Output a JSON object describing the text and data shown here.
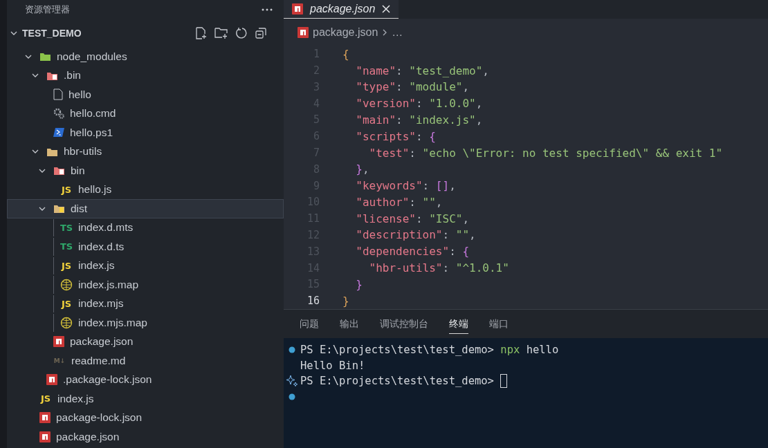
{
  "explorer": {
    "title": "资源管理器",
    "root": {
      "label": "TEST_DEMO",
      "expanded": true
    },
    "tree": [
      {
        "label": "node_modules",
        "kind": "folder-node",
        "expanded": true,
        "selected": false,
        "children": [
          {
            "label": ".bin",
            "kind": "folder-bin",
            "expanded": true,
            "selected": false,
            "children": [
              {
                "label": "hello",
                "kind": "file",
                "selected": false
              },
              {
                "label": "hello.cmd",
                "kind": "gear",
                "selected": false
              },
              {
                "label": "hello.ps1",
                "kind": "powershell",
                "selected": false
              }
            ]
          },
          {
            "label": "hbr-utils",
            "kind": "folder",
            "expanded": true,
            "selected": false,
            "children": [
              {
                "label": "bin",
                "kind": "folder-bin",
                "expanded": true,
                "selected": false,
                "children": [
                  {
                    "label": "hello.js",
                    "kind": "js",
                    "badge": "JS",
                    "selected": false
                  }
                ]
              },
              {
                "label": "dist",
                "kind": "folder-dist",
                "expanded": true,
                "selected": true,
                "children": [
                  {
                    "label": "index.d.mts",
                    "kind": "ts",
                    "badge": "TS",
                    "selected": false
                  },
                  {
                    "label": "index.d.ts",
                    "kind": "ts",
                    "badge": "TS",
                    "selected": false
                  },
                  {
                    "label": "index.js",
                    "kind": "js",
                    "badge": "JS",
                    "selected": false
                  },
                  {
                    "label": "index.js.map",
                    "kind": "map",
                    "selected": false
                  },
                  {
                    "label": "index.mjs",
                    "kind": "js",
                    "badge": "JS",
                    "selected": false
                  },
                  {
                    "label": "index.mjs.map",
                    "kind": "map",
                    "selected": false
                  }
                ]
              },
              {
                "label": "package.json",
                "kind": "npm",
                "selected": false
              },
              {
                "label": "readme.md",
                "kind": "markdown",
                "badge": "M↓",
                "selected": false
              }
            ]
          },
          {
            "label": ".package-lock.json",
            "kind": "npm",
            "selected": false
          }
        ]
      },
      {
        "label": "index.js",
        "kind": "js",
        "badge": "JS",
        "selected": false
      },
      {
        "label": "package-lock.json",
        "kind": "npm",
        "selected": false
      },
      {
        "label": "package.json",
        "kind": "npm",
        "selected": false
      }
    ]
  },
  "editor": {
    "tab": {
      "label": "package.json",
      "selected": true,
      "preview": true
    },
    "breadcrumb": {
      "file": "package.json",
      "more": "…"
    },
    "lines": [
      {
        "number": "1",
        "current": false,
        "tokens": [
          {
            "kind": "brace1",
            "text": "{"
          }
        ]
      },
      {
        "number": "2",
        "current": false,
        "tokens": [
          {
            "kind": "key",
            "text": "  \"name\""
          },
          {
            "kind": "punct",
            "text": ": "
          },
          {
            "kind": "string",
            "text": "\"test_demo\""
          },
          {
            "kind": "punct",
            "text": ","
          }
        ]
      },
      {
        "number": "3",
        "current": false,
        "tokens": [
          {
            "kind": "key",
            "text": "  \"type\""
          },
          {
            "kind": "punct",
            "text": ": "
          },
          {
            "kind": "string",
            "text": "\"module\""
          },
          {
            "kind": "punct",
            "text": ","
          }
        ]
      },
      {
        "number": "4",
        "current": false,
        "tokens": [
          {
            "kind": "key",
            "text": "  \"version\""
          },
          {
            "kind": "punct",
            "text": ": "
          },
          {
            "kind": "string",
            "text": "\"1.0.0\""
          },
          {
            "kind": "punct",
            "text": ","
          }
        ]
      },
      {
        "number": "5",
        "current": false,
        "tokens": [
          {
            "kind": "key",
            "text": "  \"main\""
          },
          {
            "kind": "punct",
            "text": ": "
          },
          {
            "kind": "string",
            "text": "\"index.js\""
          },
          {
            "kind": "punct",
            "text": ","
          }
        ]
      },
      {
        "number": "6",
        "current": false,
        "tokens": [
          {
            "kind": "key",
            "text": "  \"scripts\""
          },
          {
            "kind": "punct",
            "text": ": "
          },
          {
            "kind": "brace2",
            "text": "{"
          }
        ]
      },
      {
        "number": "7",
        "current": false,
        "tokens": [
          {
            "kind": "key",
            "text": "    \"test\""
          },
          {
            "kind": "punct",
            "text": ": "
          },
          {
            "kind": "string",
            "text": "\"echo \\\"Error: no test specified\\\" && exit 1\""
          }
        ]
      },
      {
        "number": "8",
        "current": false,
        "tokens": [
          {
            "kind": "brace2",
            "text": "  }"
          },
          {
            "kind": "punct",
            "text": ","
          }
        ]
      },
      {
        "number": "9",
        "current": false,
        "tokens": [
          {
            "kind": "key",
            "text": "  \"keywords\""
          },
          {
            "kind": "punct",
            "text": ": "
          },
          {
            "kind": "brace2",
            "text": "[]"
          },
          {
            "kind": "punct",
            "text": ","
          }
        ]
      },
      {
        "number": "10",
        "current": false,
        "tokens": [
          {
            "kind": "key",
            "text": "  \"author\""
          },
          {
            "kind": "punct",
            "text": ": "
          },
          {
            "kind": "string",
            "text": "\"\""
          },
          {
            "kind": "punct",
            "text": ","
          }
        ]
      },
      {
        "number": "11",
        "current": false,
        "tokens": [
          {
            "kind": "key",
            "text": "  \"license\""
          },
          {
            "kind": "punct",
            "text": ": "
          },
          {
            "kind": "string",
            "text": "\"ISC\""
          },
          {
            "kind": "punct",
            "text": ","
          }
        ]
      },
      {
        "number": "12",
        "current": false,
        "tokens": [
          {
            "kind": "key",
            "text": "  \"description\""
          },
          {
            "kind": "punct",
            "text": ": "
          },
          {
            "kind": "string",
            "text": "\"\""
          },
          {
            "kind": "punct",
            "text": ","
          }
        ]
      },
      {
        "number": "13",
        "current": false,
        "tokens": [
          {
            "kind": "key",
            "text": "  \"dependencies\""
          },
          {
            "kind": "punct",
            "text": ": "
          },
          {
            "kind": "brace2",
            "text": "{"
          }
        ]
      },
      {
        "number": "14",
        "current": false,
        "tokens": [
          {
            "kind": "key",
            "text": "    \"hbr-utils\""
          },
          {
            "kind": "punct",
            "text": ": "
          },
          {
            "kind": "string",
            "text": "\"^1.0.1\""
          }
        ]
      },
      {
        "number": "15",
        "current": false,
        "tokens": [
          {
            "kind": "brace2",
            "text": "  }"
          }
        ]
      },
      {
        "number": "16",
        "current": true,
        "tokens": [
          {
            "kind": "brace1",
            "text": "}"
          }
        ]
      }
    ]
  },
  "panel": {
    "tabs": [
      {
        "label": "问题",
        "selected": false
      },
      {
        "label": "输出",
        "selected": false
      },
      {
        "label": "调试控制台",
        "selected": false
      },
      {
        "label": "终端",
        "selected": true
      },
      {
        "label": "端口",
        "selected": false
      }
    ],
    "terminal": [
      {
        "kind": "dot",
        "cursor": false,
        "tokens": [
          {
            "kind": "plain",
            "text": "PS E:\\projects\\test\\test_demo> "
          },
          {
            "kind": "command",
            "text": "npx"
          },
          {
            "kind": "plain",
            "text": " hello"
          }
        ]
      },
      {
        "kind": "plain",
        "cursor": false,
        "tokens": [
          {
            "kind": "plain",
            "text": "Hello Bin!"
          }
        ]
      },
      {
        "kind": "sparkle",
        "cursor": true,
        "tokens": [
          {
            "kind": "plain",
            "text": "PS E:\\projects\\test\\test_demo> "
          }
        ]
      },
      {
        "kind": "dot",
        "cursor": false
      }
    ]
  }
}
